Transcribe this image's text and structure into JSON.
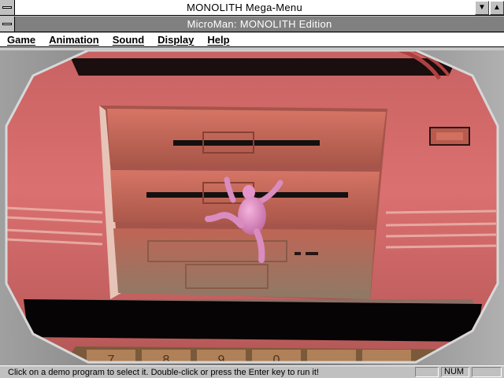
{
  "outer_window": {
    "title": "MONOLITH Mega-Menu"
  },
  "inner_window": {
    "title": "MicroMan: MONOLITH Edition"
  },
  "menu": {
    "items": [
      "Game",
      "Animation",
      "Sound",
      "Display",
      "Help"
    ]
  },
  "keys": [
    "7",
    "8",
    "9",
    "0"
  ],
  "status": {
    "message": "Click on a demo program to select it.  Double-click or press the Enter key to run it!",
    "indicator_1": "",
    "indicator_2": "NUM",
    "indicator_3": ""
  },
  "colors": {
    "pc_case": "#d66a6c",
    "figure": "#e690c8",
    "frame": "#8a8a8a"
  }
}
